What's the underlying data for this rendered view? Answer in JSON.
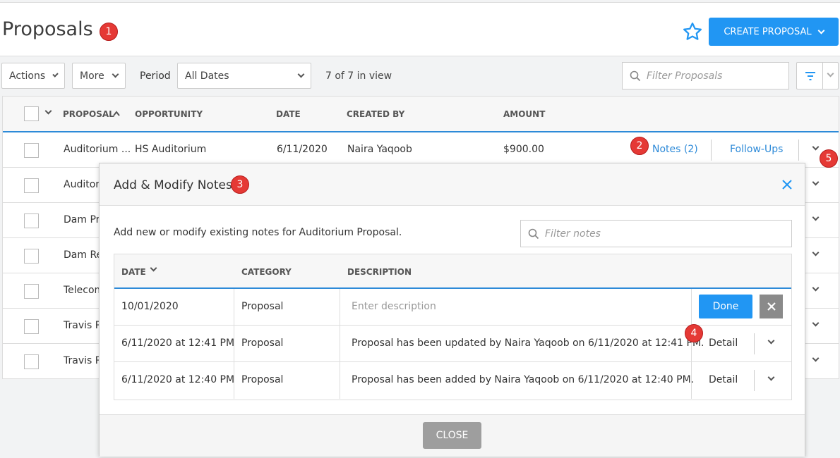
{
  "header": {
    "title": "Proposals",
    "create_label": "CREATE PROPOSAL",
    "badges": [
      "1",
      "2",
      "3",
      "4",
      "5"
    ]
  },
  "toolbar": {
    "actions_label": "Actions",
    "more_label": "More",
    "period_label": "Period",
    "period_value": "All Dates",
    "in_view": "7 of 7 in view",
    "filter_placeholder": "Filter Proposals"
  },
  "table": {
    "columns": [
      "PROPOSAL",
      "OPPORTUNITY",
      "DATE",
      "CREATED BY",
      "AMOUNT"
    ],
    "first_row": {
      "proposal": "Auditorium ...",
      "opportunity": "HS Auditorium",
      "date": "6/11/2020",
      "created_by": "Naira Yaqoob",
      "amount": "$900.00",
      "notes_link": "Notes (2)",
      "followups_link": "Follow-Ups"
    },
    "other_rows": [
      "Auditori",
      "Dam Pr",
      "Dam Re",
      "Telecom",
      "Travis P",
      "Travis P"
    ]
  },
  "modal": {
    "title": "Add & Modify Notes",
    "description": "Add new or modify existing notes for Auditorium Proposal.",
    "filter_placeholder": "Filter notes",
    "columns": [
      "DATE",
      "CATEGORY",
      "DESCRIPTION"
    ],
    "new_row": {
      "date": "10/01/2020",
      "category": "Proposal",
      "placeholder": "Enter description",
      "done_label": "Done"
    },
    "notes": [
      {
        "date": "6/11/2020 at 12:41 PM",
        "category": "Proposal",
        "description": "Proposal has been updated by Naira Yaqoob on 6/11/2020 at 12:41 PM.",
        "action": "Detail"
      },
      {
        "date": "6/11/2020 at 12:40 PM",
        "category": "Proposal",
        "description": "Proposal has been added by Naira Yaqoob on 6/11/2020 at 12:40 PM.",
        "action": "Detail"
      }
    ],
    "close_label": "CLOSE"
  },
  "colors": {
    "accent": "#2196f3",
    "badge": "#e53935",
    "link": "#2d8ad8"
  }
}
